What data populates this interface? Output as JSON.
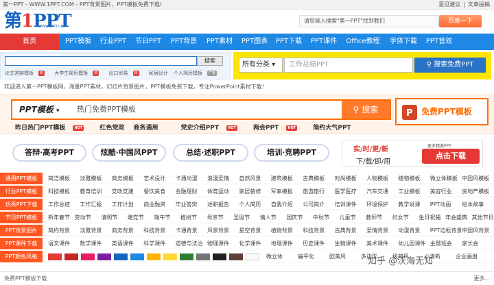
{
  "topbar": {
    "left": "第一PPT - WWW.1PPT.COM - PPT背景图片，PPT模板免费下载!",
    "links": [
      "意见建议",
      "文章投稿"
    ]
  },
  "logo": {
    "text_a": "第",
    "text_b": "1",
    "text_c": "PPT",
    "url": "WWW.1PPT.COM"
  },
  "search": {
    "placeholder": "请您输入搜索\"第一PPT\"找到我们",
    "button": "百度一下"
  },
  "nav": [
    "首页",
    "PPT模板",
    "行业PPT",
    "节日PPT",
    "PPT背景",
    "PPT素材",
    "PPT图表",
    "PPT下载",
    "PPT课件",
    "Office教程",
    "字体下载",
    "PPT音效"
  ],
  "sub1": {
    "button": "搜索",
    "links": [
      "论文答辩模板",
      "大学生简历模板",
      "出口贸易",
      "民宿设计",
      "个人简历模板"
    ],
    "hot_badge": "热",
    "ad_label": "广告"
  },
  "sub2": {
    "select": "所有分类",
    "placeholder": "工作总结PPT",
    "button": "搜索免费PPT"
  },
  "welcome": "欢迎进入第一PPT模板网，海量PPT素材，幻灯片背景图片，PPT模板免费下载，专注PowerPoint素材下载！",
  "strip": {
    "category": "PPT模板",
    "keyword": "热门免费PPT模板",
    "search": "搜索",
    "free": "免费PPT模板",
    "hot": [
      {
        "t": "昨日热门PPT模板",
        "hot": true
      },
      {
        "t": "红色党政",
        "hot": false
      },
      {
        "t": "商务通用",
        "hot": false
      },
      {
        "t": "党史介绍PPT",
        "hot": true
      },
      {
        "t": "两会PPT",
        "hot": true
      },
      {
        "t": "简约大气PPT",
        "hot": false
      }
    ],
    "hot_badge": "HOT"
  },
  "tags": [
    "答辩·高考PPT",
    "炫酷·中国风PPT",
    "总结·述职PPT",
    "培训·竞聘PPT"
  ],
  "ad": {
    "line1": "实/时/更/新",
    "line2": "下/载/即/用",
    "more": "更多精美PPT",
    "button": "点击下载"
  },
  "rows": [
    {
      "label": "通用PPT模板",
      "items": [
        "简洁模板",
        "淡雅模板",
        "商务模板",
        "艺术设计",
        "卡通动漫",
        "浪漫爱情",
        "自然风景",
        "建筑模板",
        "古典模板",
        "时尚模板",
        "人物模板",
        "植物模板",
        "微立体模板",
        "中国风模板"
      ]
    },
    {
      "label": "行业PPT模板",
      "items": [
        "科技模板",
        "教育培训",
        "党政党建",
        "餐饮美食",
        "金融理财",
        "体育运动",
        "家居装修",
        "军事模板",
        "旅游旅行",
        "医学医疗",
        "汽车交通",
        "工业模板",
        "美容行业",
        "房地产模板"
      ]
    },
    {
      "label": "优秀PPT下载",
      "items": [
        "工作总结",
        "工作汇报",
        "工作计划",
        "商业融资",
        "毕业答辩",
        "述职报告",
        "个人简历",
        "自我介绍",
        "公司简介",
        "培训课件",
        "环境保护",
        "教学说课",
        "PPT动画",
        "绘本故事"
      ]
    },
    {
      "label": "节日PPT模板",
      "items": [
        "新年春节",
        "劳动节",
        "清明节",
        "建党节",
        "端午节",
        "植树节",
        "母亲节",
        "圣诞节",
        "情人节",
        "国庆节",
        "中秋节",
        "儿童节",
        "教师节",
        "妇女节",
        "生日祝福",
        "年会盛典",
        "其他节日"
      ]
    },
    {
      "label": "PPT背景图片",
      "items": [
        "简约背景",
        "淡雅背景",
        "商务背景",
        "科技背景",
        "卡通背景",
        "风景背景",
        "星空背景",
        "植物背景",
        "科技背景",
        "古典背景",
        "爱情背景",
        "动漫背景",
        "PPT边框背景",
        "中国风背景"
      ]
    },
    {
      "label": "PPT课件下载",
      "items": [
        "语文课件",
        "数学课件",
        "英语课件",
        "科学课件",
        "道德与法治",
        "物理课件",
        "化学课件",
        "地理课件",
        "历史课件",
        "生物课件",
        "美术课件",
        "幼儿园课件",
        "主题班会",
        "家长会"
      ]
    },
    {
      "label": "PPT颜色风格",
      "items": [
        "微立体",
        "扁平化",
        "欧美风",
        "多边形",
        "极简风",
        "小清新",
        "企业画册"
      ]
    }
  ],
  "swatches": [
    "#e53935",
    "#c62828",
    "#e91e63",
    "#7b1fa2",
    "#1565c0",
    "#1e88e5",
    "#ffb300",
    "#fdd835",
    "#2e7d32",
    "#757575",
    "#212121",
    "#5d4037",
    "#fafafa"
  ],
  "footer": {
    "left": "免费PPT模板下载",
    "right": "更多..."
  },
  "watermark": "知乎 @沃海无知"
}
